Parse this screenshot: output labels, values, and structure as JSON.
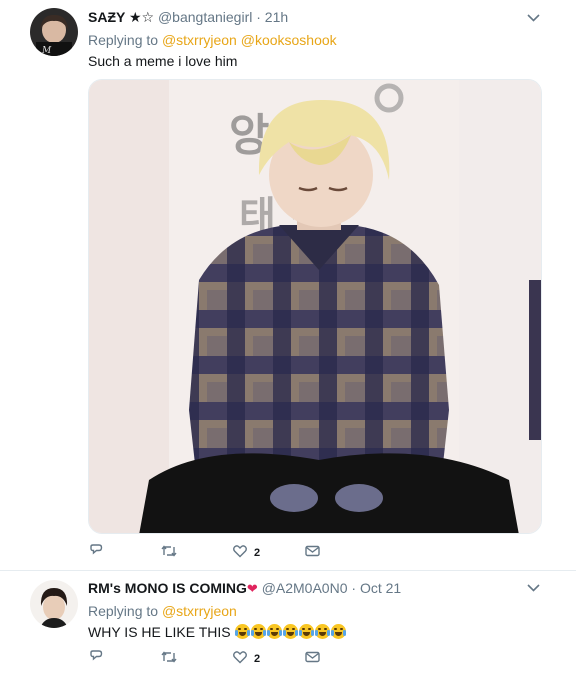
{
  "tweets": [
    {
      "author": {
        "name": "SAƵY ★☆",
        "handle": "@bangtaniegirl",
        "time": "· 21h"
      },
      "reply": {
        "prefix": "Replying to",
        "mentions": [
          "@stxrryjeon",
          "@kooksoshook"
        ]
      },
      "text": "Such a meme i love him",
      "actions": {
        "reply_count": "",
        "retweet_count": "",
        "like_count": "2"
      }
    },
    {
      "author": {
        "name": "RM's MONO IS COMING",
        "handle": "@A2M0A0N0",
        "time": "· Oct 21"
      },
      "reply": {
        "prefix": "Replying to",
        "mentions": [
          "@stxrryjeon"
        ]
      },
      "text": "WHY IS HE LIKE THIS",
      "emojis": [
        "crying-face",
        "crying-face",
        "tears-of-joy",
        "tears-of-joy",
        "tears-of-joy",
        "tears-of-joy",
        "tears-of-joy"
      ],
      "actions": {
        "reply_count": "",
        "retweet_count": "",
        "like_count": "2"
      }
    }
  ],
  "colors": {
    "link_accent": "#e8a618",
    "secondary_text": "#657786",
    "heart": "#e0245e"
  }
}
